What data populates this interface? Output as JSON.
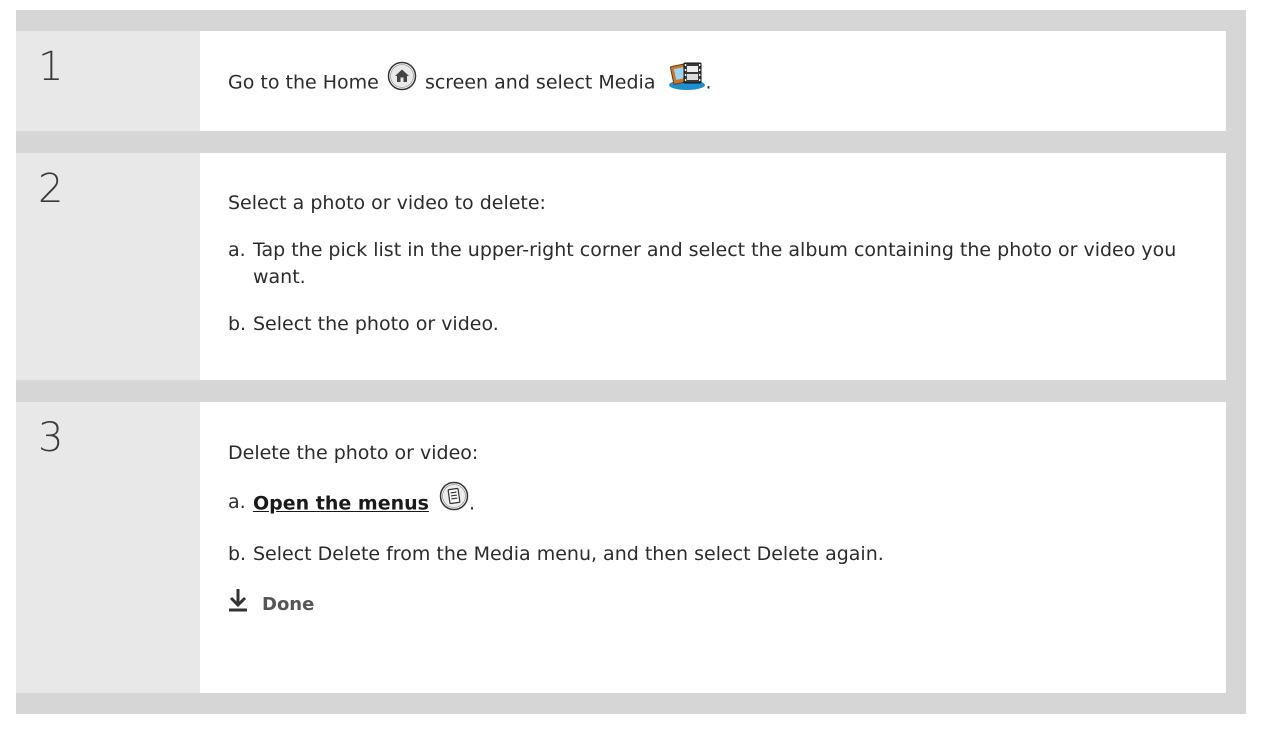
{
  "steps": [
    {
      "number": "1",
      "text_before": "Go to the Home",
      "home_icon": "home-icon",
      "text_middle": "screen and select Media",
      "media_icon": "media-app-icon",
      "text_after": "."
    },
    {
      "number": "2",
      "intro": "Select a photo or video to delete:",
      "items": [
        {
          "letter": "a.",
          "text": "Tap the pick list in the upper-right corner and select the album containing the photo or video you want."
        },
        {
          "letter": "b.",
          "text": "Select the photo or video."
        }
      ]
    },
    {
      "number": "3",
      "intro": "Delete the photo or video:",
      "item_a_letter": "a.",
      "item_a_link": "Open the menus",
      "menu_icon": "menu-icon",
      "item_a_after": ".",
      "item_b_letter": "b.",
      "item_b_text": "Select Delete from the Media menu, and then select Delete again.",
      "done_icon": "down-arrow-icon",
      "done_label": "Done"
    }
  ],
  "colors": {
    "outer_gray": "#d6d6d6",
    "number_cell": "#e8e8e8",
    "text": "#2b2b2b",
    "done_gray": "#555555"
  }
}
